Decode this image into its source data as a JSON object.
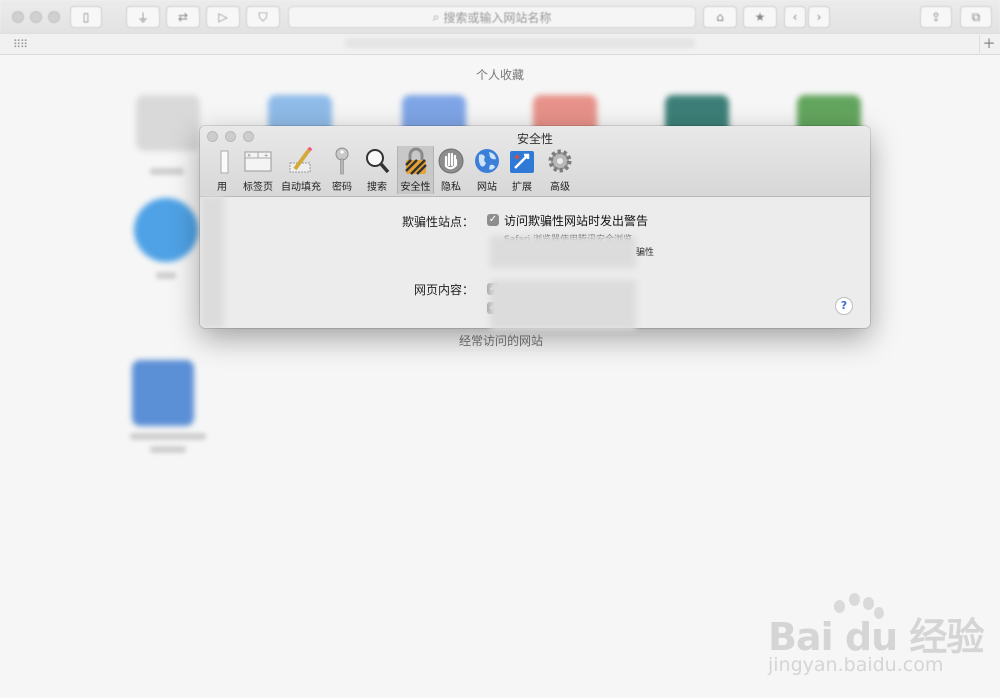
{
  "browser": {
    "address_placeholder": "搜索或输入网站名称"
  },
  "page": {
    "favorites_title": "个人收藏",
    "frequent_title": "经常访问的网站"
  },
  "preferences": {
    "title": "安全性",
    "tabs": [
      {
        "label": "用",
        "icon": "general-icon",
        "active": false
      },
      {
        "label": "标签页",
        "icon": "tabs-icon",
        "active": false
      },
      {
        "label": "自动填充",
        "icon": "autofill-pencil-icon",
        "active": false
      },
      {
        "label": "密码",
        "icon": "key-icon",
        "active": false
      },
      {
        "label": "搜索",
        "icon": "magnifier-icon",
        "active": false
      },
      {
        "label": "安全性",
        "icon": "lock-icon",
        "active": true
      },
      {
        "label": "隐私",
        "icon": "hand-icon",
        "active": false
      },
      {
        "label": "网站",
        "icon": "globe-icon",
        "active": false
      },
      {
        "label": "扩展",
        "icon": "puzzle-icon",
        "active": false
      },
      {
        "label": "高级",
        "icon": "gear-icon",
        "active": false
      }
    ],
    "fraud_label": "欺骗性站点：",
    "fraud_option": "访问欺骗性网站时发出警告",
    "fraud_desc_line1": "Safari 浏览器使用腾讯安全浏览",
    "fraud_desc_line2": "骗性",
    "web_content_label": "网页内容："
  },
  "watermark": {
    "brand": "Bai du 经验",
    "url": "jingyan.baidu.com"
  }
}
